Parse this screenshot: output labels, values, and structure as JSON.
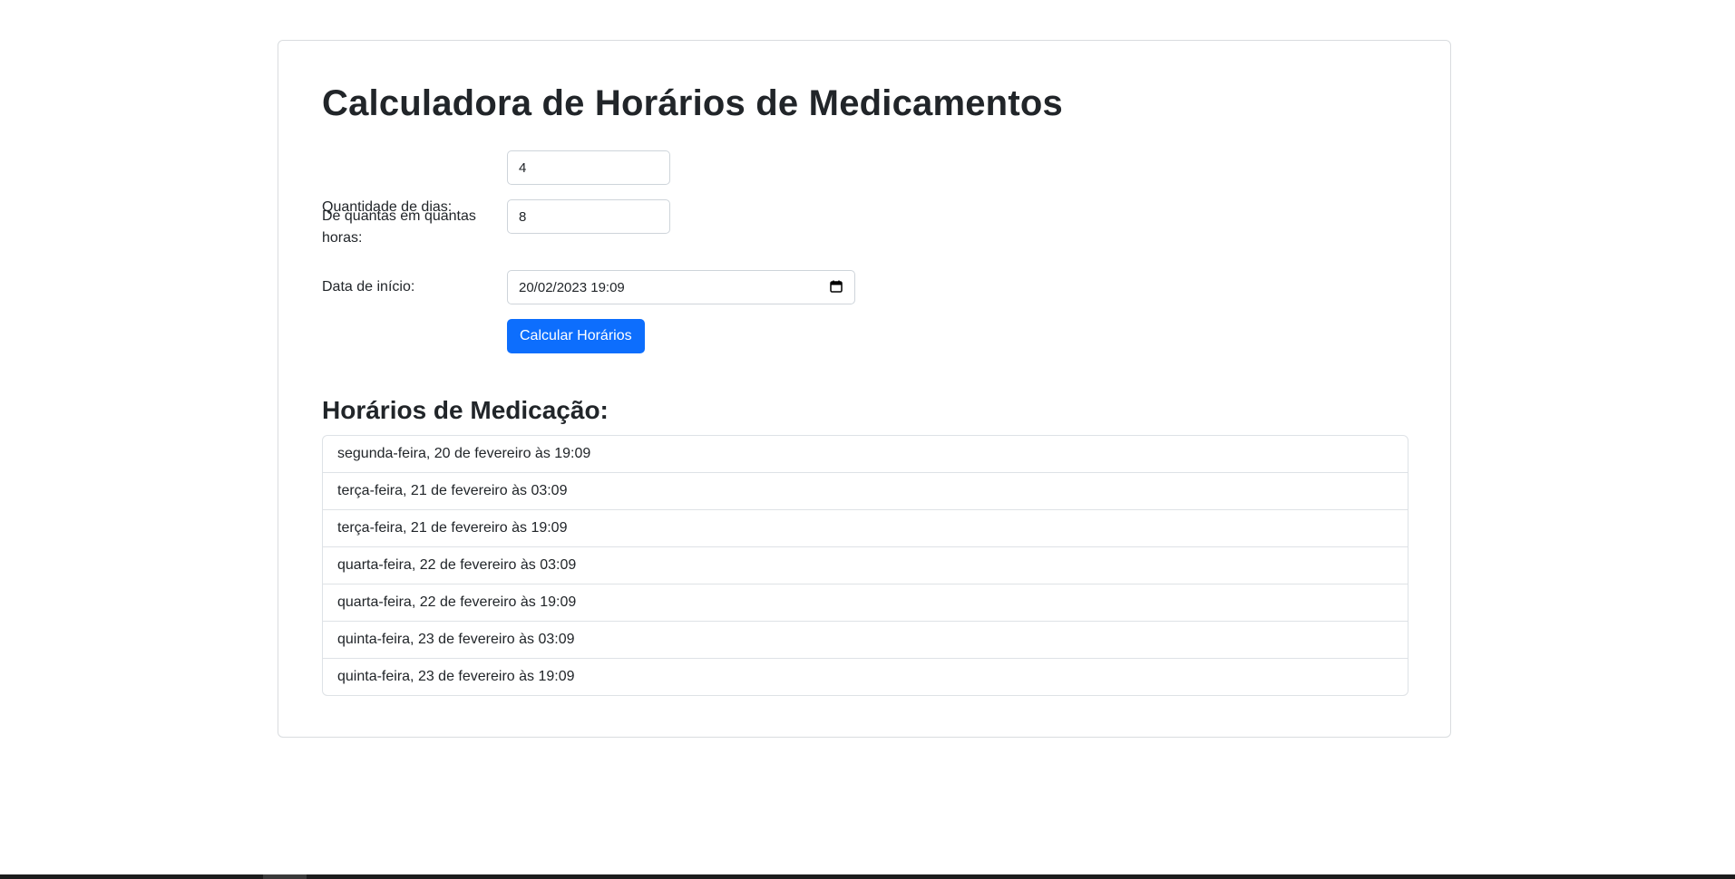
{
  "calculator": {
    "title": "Calculadora de Horários de Medicamentos",
    "fields": {
      "days_label": "Quantidade de dias:",
      "days_value": "4",
      "interval_label": "De quantas em quantas horas:",
      "interval_value": "8",
      "start_label": "Data de início:",
      "start_value": "20/02/2023 19:09"
    },
    "calculate_button": "Calcular Horários",
    "icons": {
      "calendar": "calendar-icon"
    }
  },
  "schedule": {
    "heading": "Horários de Medicação:",
    "items": [
      "segunda-feira, 20 de fevereiro às 19:09",
      "terça-feira, 21 de fevereiro às 03:09",
      "terça-feira, 21 de fevereiro às 19:09",
      "quarta-feira, 22 de fevereiro às 03:09",
      "quarta-feira, 22 de fevereiro às 19:09",
      "quinta-feira, 23 de fevereiro às 03:09",
      "quinta-feira, 23 de fevereiro às 19:09"
    ]
  }
}
